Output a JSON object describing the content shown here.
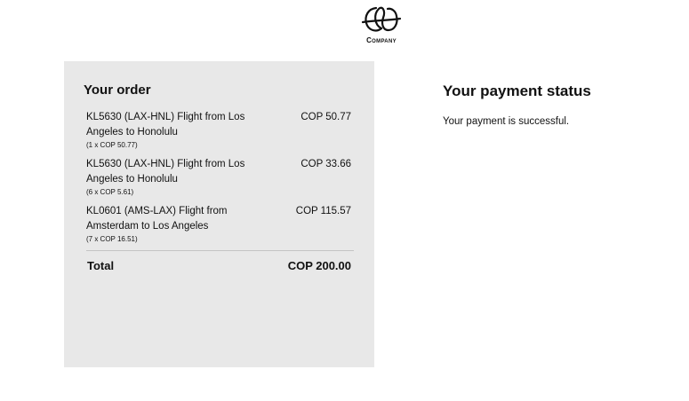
{
  "header": {
    "logo_text": "Company"
  },
  "order": {
    "title": "Your order",
    "items": [
      {
        "name": "KL5630 (LAX-HNL) Flight from Los Angeles to Honolulu",
        "quantity_note": "(1 x COP 50.77)",
        "price": "COP 50.77"
      },
      {
        "name": "KL5630 (LAX-HNL) Flight from Los Angeles to Honolulu",
        "quantity_note": "(6 x COP 5.61)",
        "price": "COP 33.66"
      },
      {
        "name": "KL0601 (AMS-LAX) Flight from Amsterdam to Los Angeles",
        "quantity_note": "(7 x COP 16.51)",
        "price": "COP 115.57"
      }
    ],
    "total_label": "Total",
    "total_value": "COP 200.00"
  },
  "payment": {
    "title": "Your payment status",
    "message": "Your payment is successful."
  },
  "colors": {
    "panel_background": "#e8e8e8",
    "text": "#111111"
  }
}
